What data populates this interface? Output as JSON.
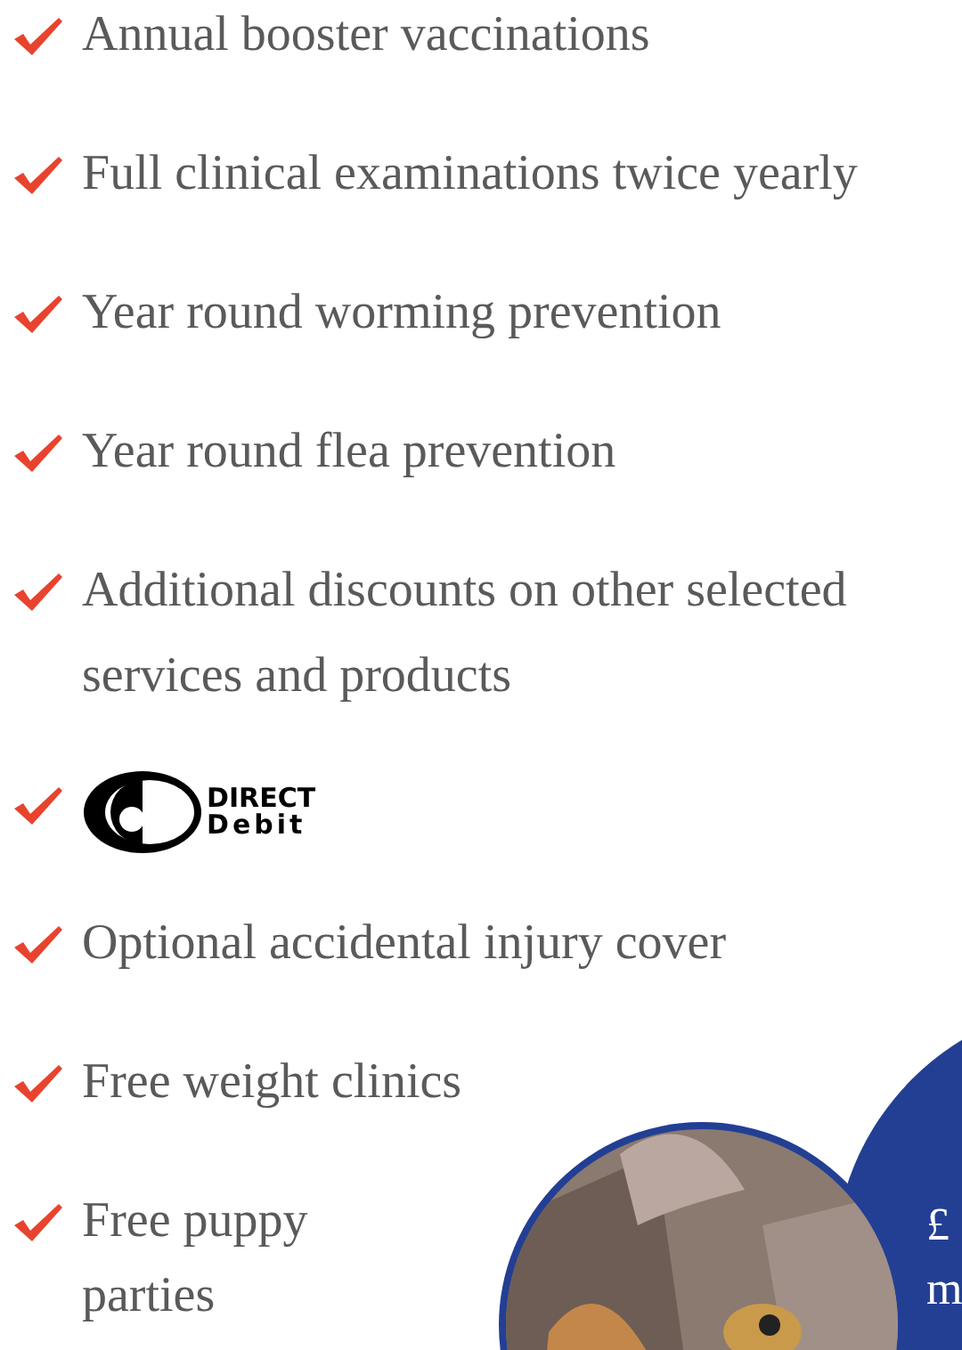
{
  "benefits": [
    {
      "kind": "text",
      "text": "Annual booster vaccinations"
    },
    {
      "kind": "text",
      "text": "Full clinical examinations twice yearly"
    },
    {
      "kind": "text",
      "text": "Year round worming prevention"
    },
    {
      "kind": "text",
      "text": "Year round flea prevention"
    },
    {
      "kind": "text",
      "text": "Additional discounts on other selected services and products"
    },
    {
      "kind": "logo",
      "logo_top": "DIRECT",
      "logo_bottom": "Debit"
    },
    {
      "kind": "text",
      "text": "Optional accidental injury cover"
    },
    {
      "kind": "text",
      "text": "Free weight clinics"
    },
    {
      "kind": "lines",
      "lines": [
        "Free puppy",
        "parties"
      ]
    }
  ],
  "promo": {
    "lines": [
      "£",
      "m"
    ]
  }
}
